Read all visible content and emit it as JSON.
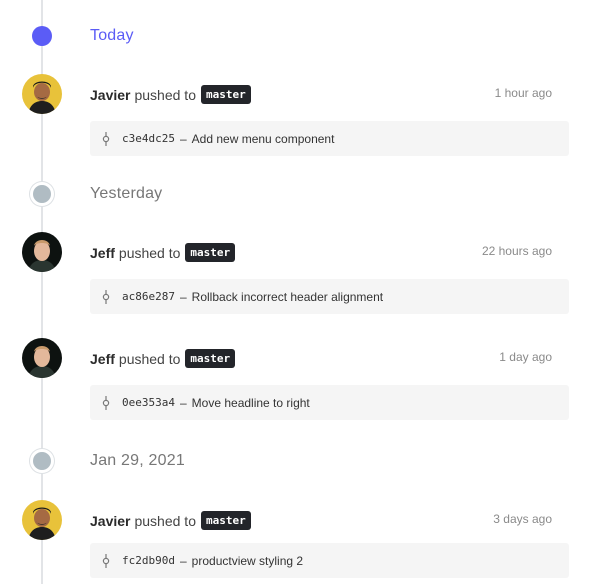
{
  "days": [
    {
      "label": "Today"
    },
    {
      "label": "Yesterday"
    },
    {
      "label": "Jan 29, 2021"
    }
  ],
  "entries": [
    {
      "user": "Javier",
      "action": "pushed to",
      "branch": "master",
      "time": "1 hour ago",
      "hash": "c3e4dc25",
      "separator": "–",
      "message": "Add new menu component"
    },
    {
      "user": "Jeff",
      "action": "pushed to",
      "branch": "master",
      "time": "22 hours ago",
      "hash": "ac86e287",
      "separator": "–",
      "message": "Rollback incorrect header alignment"
    },
    {
      "user": "Jeff",
      "action": "pushed to",
      "branch": "master",
      "time": "1 day ago",
      "hash": "0ee353a4",
      "separator": "–",
      "message": "Move headline to right"
    },
    {
      "user": "Javier",
      "action": "pushed to",
      "branch": "master",
      "time": "3 days ago",
      "hash": "fc2db90d",
      "separator": "–",
      "message": "productview styling 2"
    }
  ],
  "colors": {
    "accent": "#5b5cf6",
    "branch_bg": "#23252a",
    "past_dot": "#b0bcc3"
  },
  "icons": {
    "commit": "git-commit-icon"
  }
}
